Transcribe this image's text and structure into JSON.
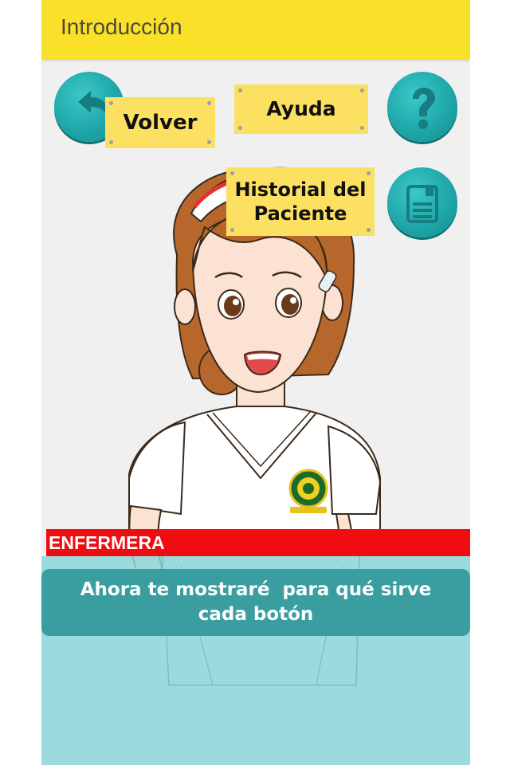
{
  "appbar": {
    "title": "Introducción"
  },
  "buttons": {
    "back": {
      "icon": "undo-arrow-icon",
      "label": "Volver"
    },
    "help": {
      "icon": "question-mark-icon",
      "label": "Ayuda"
    },
    "history": {
      "icon": "clipboard-icon",
      "label_line1": "Historial del",
      "label_line2": "Paciente"
    }
  },
  "character": {
    "role": "ENFERMERA",
    "image": "nurse-illustration"
  },
  "dialog": {
    "line1": "Ahora te mostraré  para qué sirve",
    "line2": "cada botón"
  },
  "colors": {
    "appbar": "#fbe02a",
    "note": "#fbe061",
    "teal": "#1fa7a9",
    "role_bar": "#f00d12",
    "speech": "#3a9ea0"
  }
}
